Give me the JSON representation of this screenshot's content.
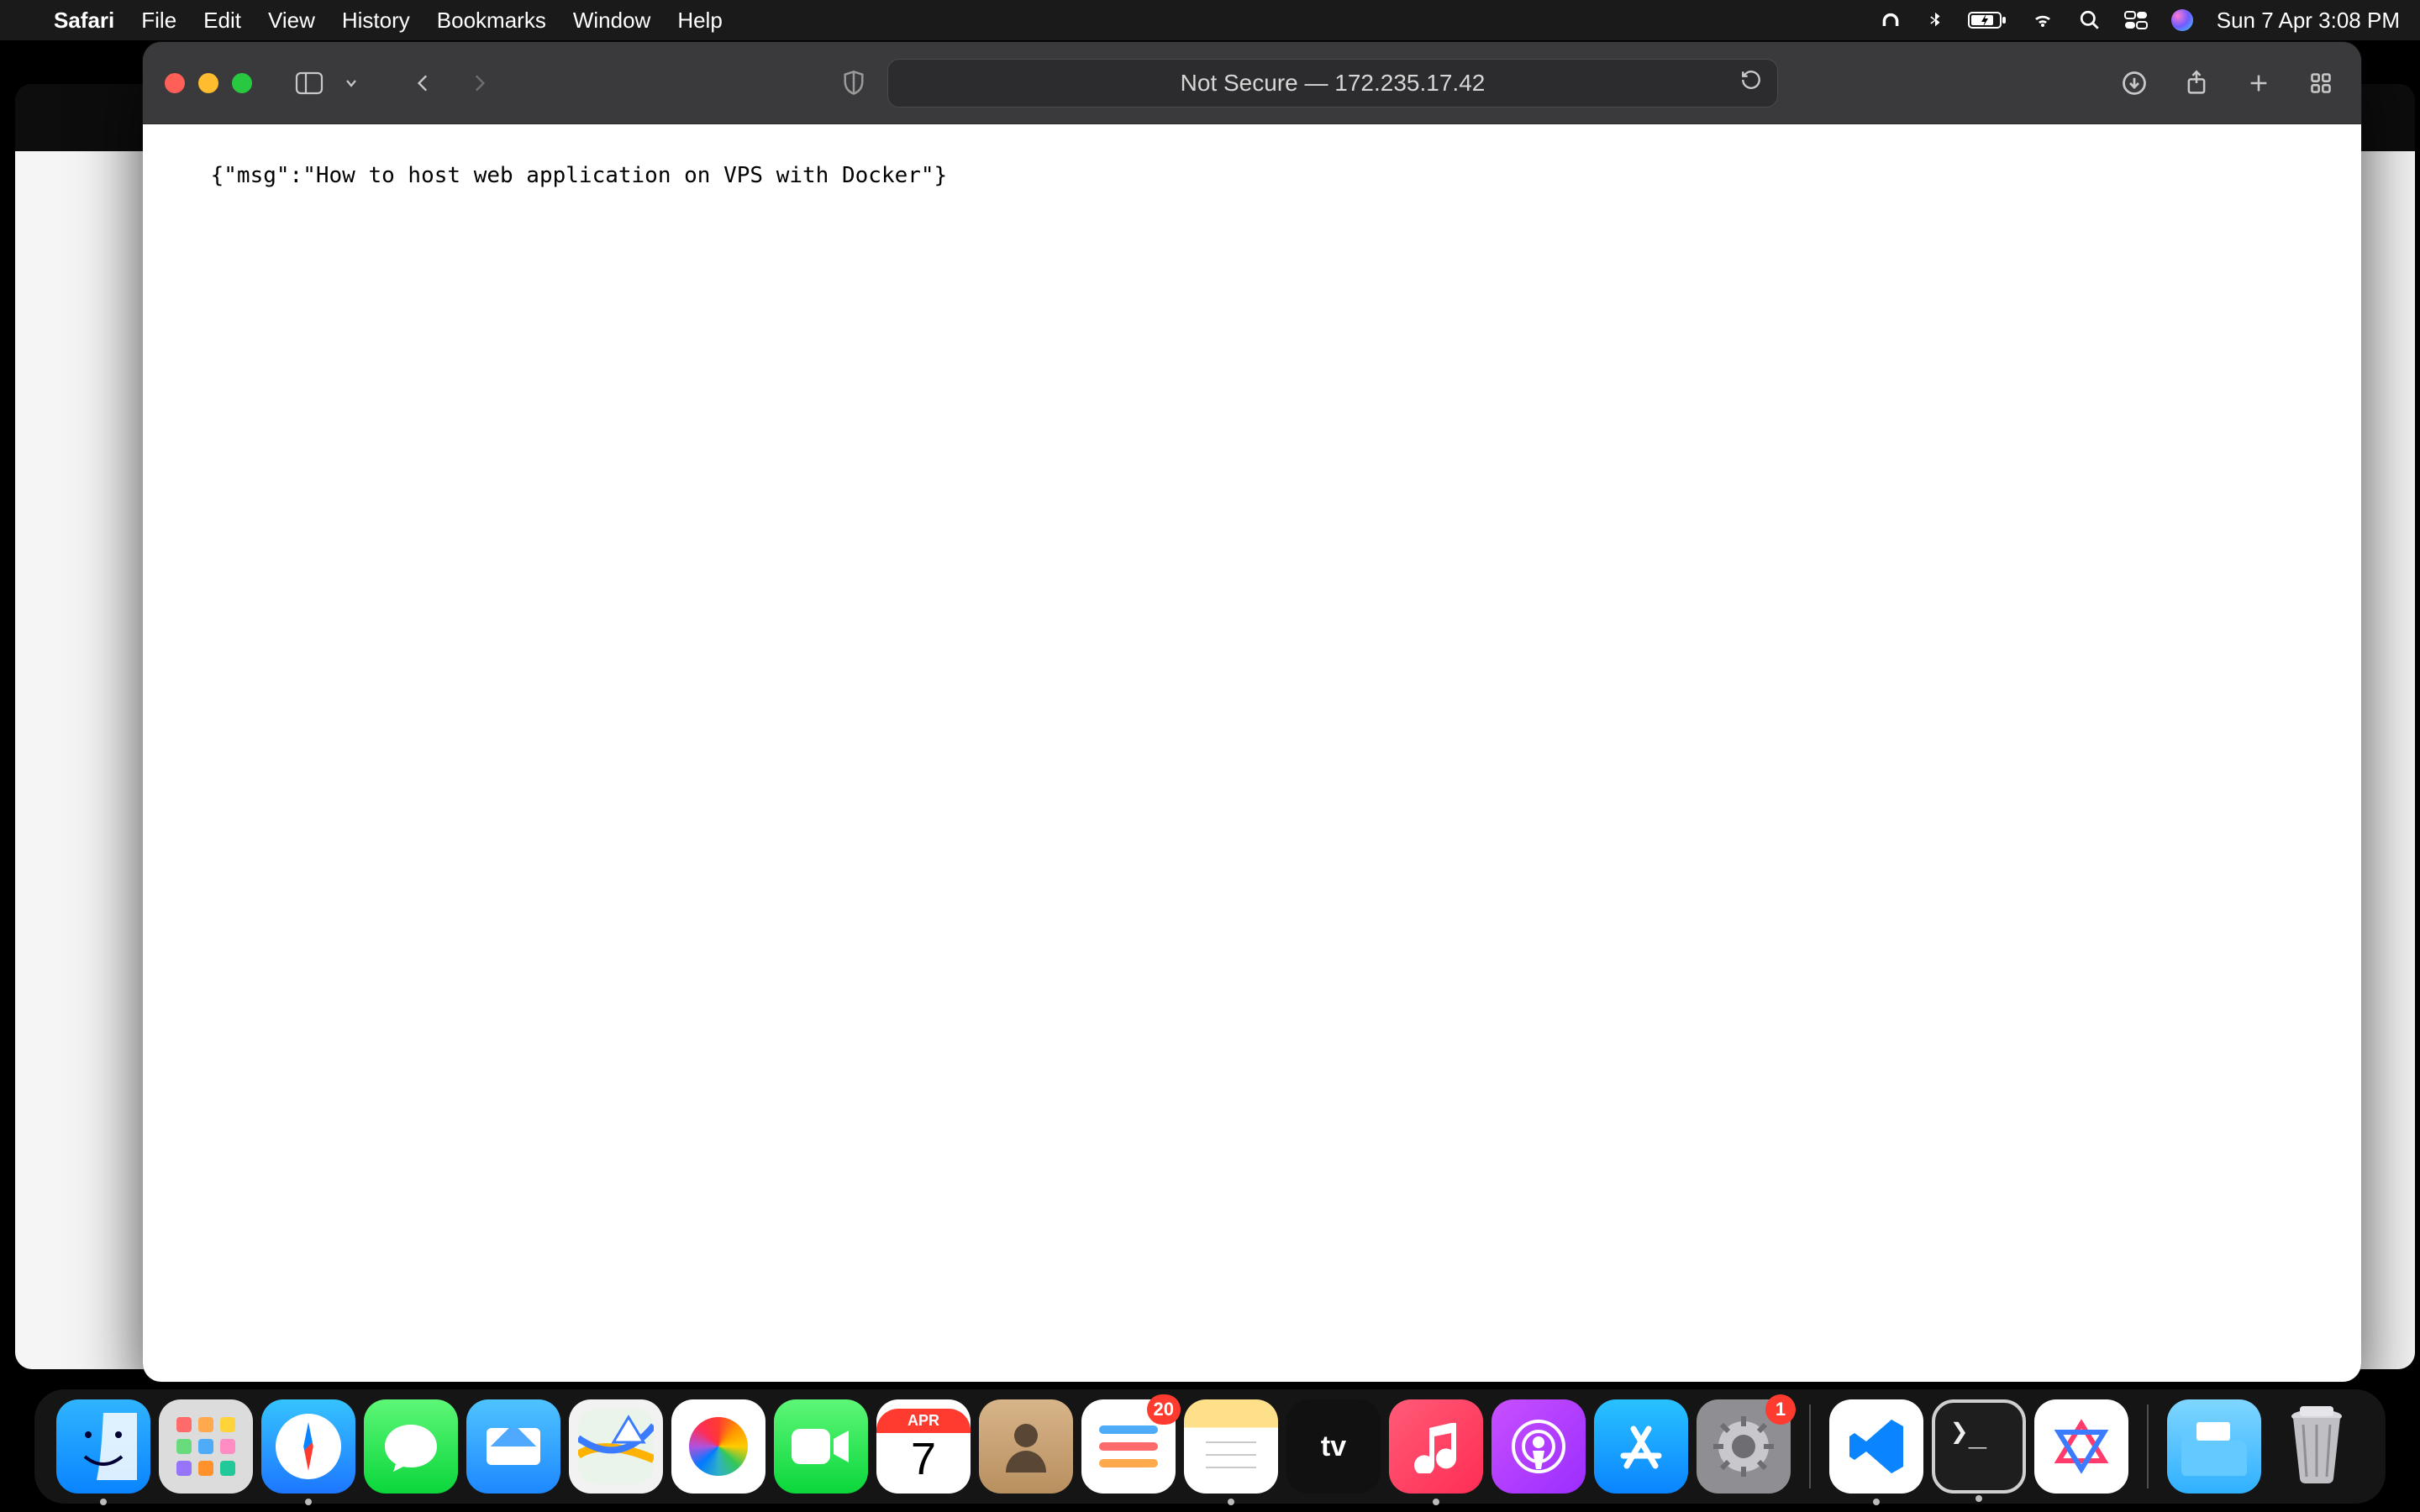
{
  "menubar": {
    "app": "Safari",
    "items": [
      "File",
      "Edit",
      "View",
      "History",
      "Bookmarks",
      "Window",
      "Help"
    ],
    "datetime": "Sun 7 Apr  3:08 PM"
  },
  "safari": {
    "address": "Not Secure — 172.235.17.42",
    "body_text": "{\"msg\":\"How to host web application on VPS with Docker\"}"
  },
  "dock": {
    "calendar_month": "APR",
    "calendar_day": "7",
    "reminders_badge": "20",
    "settings_badge": "1",
    "apps": [
      "Finder",
      "Launchpad",
      "Safari",
      "Messages",
      "Mail",
      "Maps",
      "Photos",
      "FaceTime",
      "Calendar",
      "Contacts",
      "Reminders",
      "Notes",
      "TV",
      "Music",
      "Podcasts",
      "App Store",
      "System Settings",
      "Visual Studio Code",
      "Terminal",
      "Ollama",
      "Downloads",
      "Trash"
    ],
    "running": [
      "Finder",
      "Safari",
      "Notes",
      "Music",
      "Visual Studio Code",
      "Terminal"
    ]
  }
}
